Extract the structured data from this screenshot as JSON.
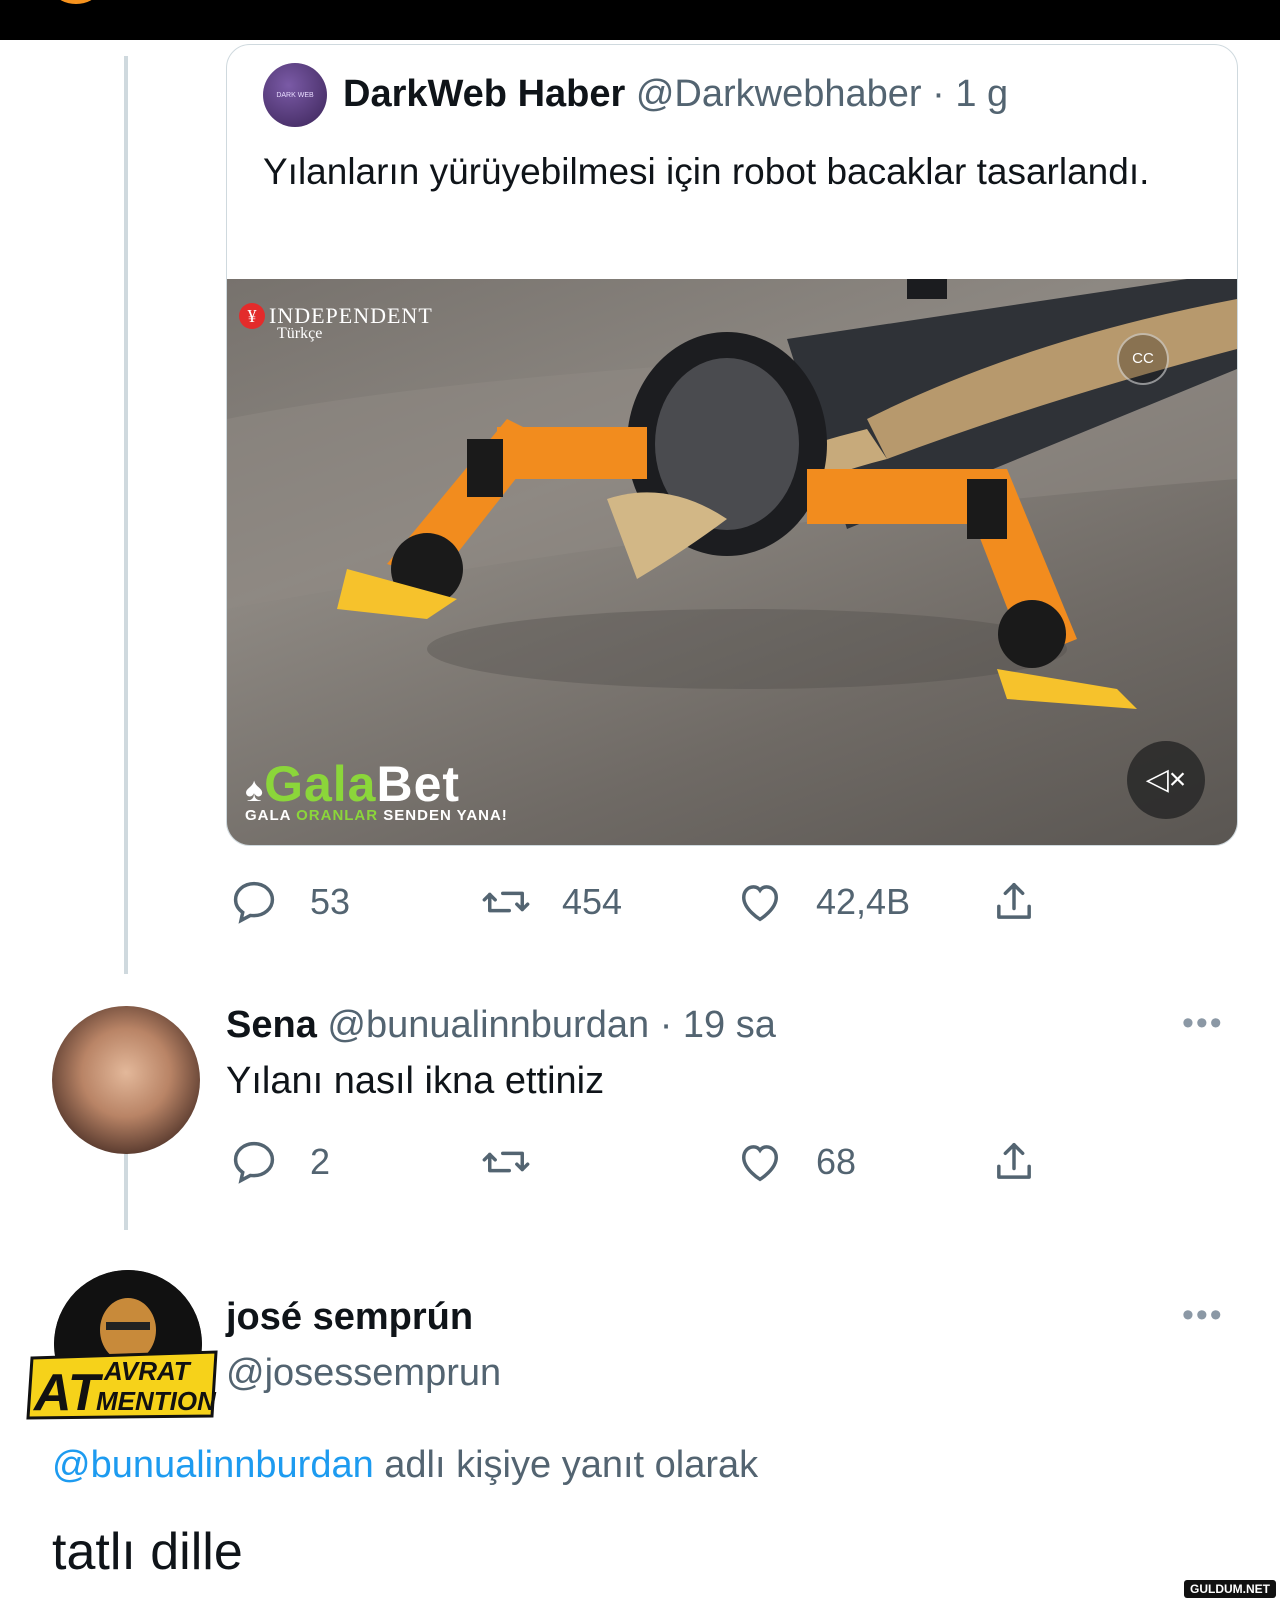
{
  "quoted_tweet": {
    "author_name": "DarkWeb Haber",
    "handle": "@Darkwebhaber",
    "separator": "·",
    "time": "1 g",
    "avatar_text": "DARK WEB",
    "text": "Yılanların yürüyebilmesi için robot bacaklar tasarlandı.",
    "media": {
      "source_logo": "INDEPENDENT",
      "source_sub": "Türkçe",
      "cc_icon": "cc-icon",
      "mute_icon": "mute-icon",
      "sponsor": {
        "part1": "Gala",
        "part2": "Bet",
        "slogan_1": "GALA ",
        "slogan_2": "ORANLAR",
        "slogan_3": " SENDEN YANA!"
      }
    },
    "stats": {
      "replies": "53",
      "retweets": "454",
      "likes": "42,4B"
    }
  },
  "reply_1": {
    "author_name": "Sena",
    "handle": "@bunualinnburdan",
    "separator": "·",
    "time": "19 sa",
    "text": "Yılanı nasıl ikna ettiniz",
    "stats": {
      "replies": "2",
      "retweets": "",
      "likes": "68"
    }
  },
  "reply_2": {
    "author_name": "josé semprún",
    "handle": "@josessemprun",
    "badge_text_1": "AT",
    "badge_text_2": "AVRAT",
    "badge_text_3": "MENTION",
    "reply_to_handle": "@bunualinnburdan",
    "reply_to_suffix": " adlı kişiye yanıt olarak",
    "text": "tatlı dille"
  },
  "watermark": "GULDUM.NET",
  "colors": {
    "accent": "#1d9bf0",
    "secondary_text": "#536471",
    "border": "#cfd9de",
    "robot_orange": "#f28c1e"
  }
}
